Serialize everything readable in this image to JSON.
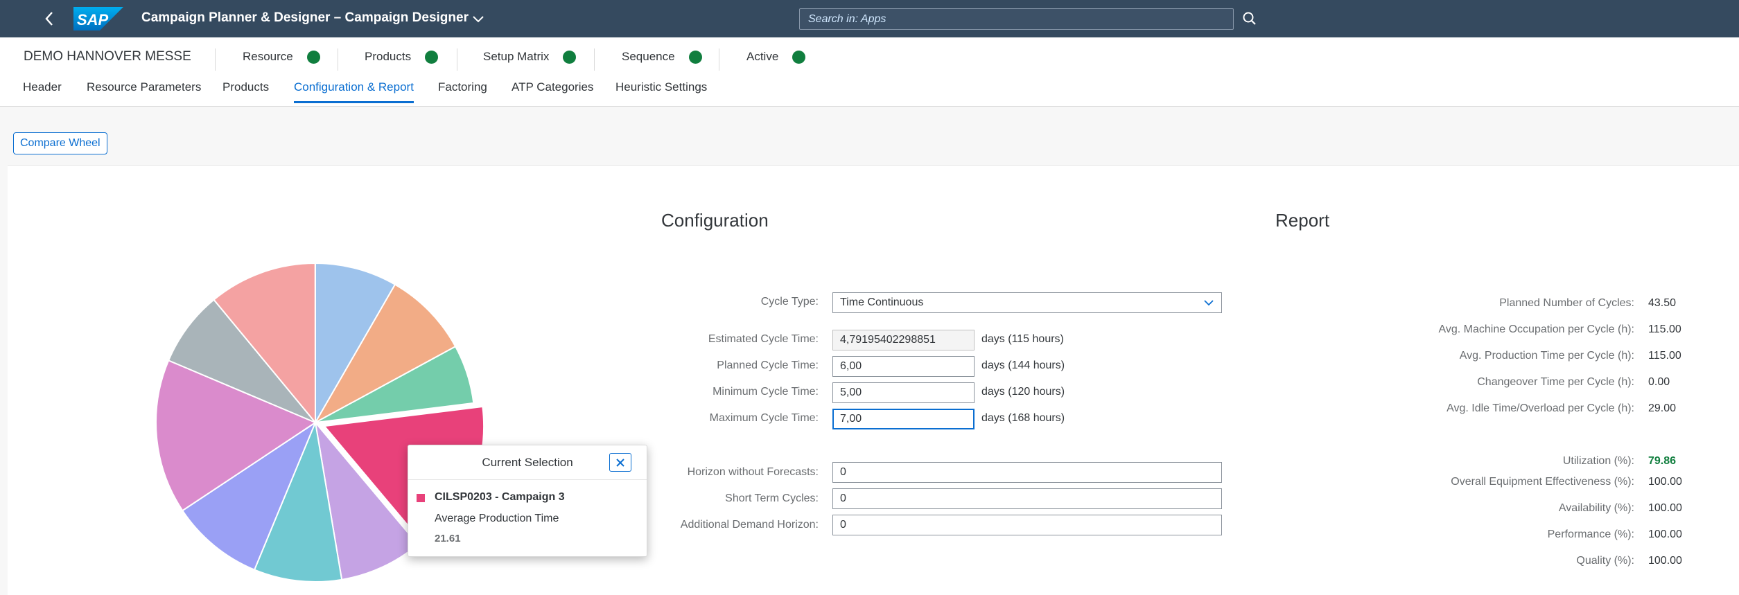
{
  "shell": {
    "logo_text": "SAP",
    "title": "Campaign Planner & Designer – Campaign Designer",
    "search_placeholder": "Search in: Apps"
  },
  "object": {
    "title": "DEMO HANNOVER MESSE",
    "statuses": [
      {
        "label": "Resource",
        "state": "green"
      },
      {
        "label": "Products",
        "state": "green"
      },
      {
        "label": "Setup Matrix",
        "state": "green"
      },
      {
        "label": "Sequence",
        "state": "green"
      },
      {
        "label": "Active",
        "state": "green"
      }
    ]
  },
  "tabs": [
    {
      "label": "Header"
    },
    {
      "label": "Resource Parameters"
    },
    {
      "label": "Products"
    },
    {
      "label": "Configuration & Report",
      "active": true
    },
    {
      "label": "Factoring"
    },
    {
      "label": "ATP Categories"
    },
    {
      "label": "Heuristic Settings"
    }
  ],
  "toolbar": {
    "compare_label": "Compare Wheel"
  },
  "configuration": {
    "title": "Configuration",
    "cycle_type_label": "Cycle Type:",
    "cycle_type_value": "Time Continuous",
    "estimated_label": "Estimated Cycle Time:",
    "estimated_value": "4,79195402298851",
    "estimated_unit": "days (115 hours)",
    "planned_label": "Planned Cycle Time:",
    "planned_value": "6,00",
    "planned_unit": "days (144 hours)",
    "minimum_label": "Minimum Cycle Time:",
    "minimum_value": "5,00",
    "minimum_unit": "days (120 hours)",
    "maximum_label": "Maximum Cycle Time:",
    "maximum_value": "7,00",
    "maximum_unit": "days (168 hours)",
    "horizon_label": "Horizon without Forecasts:",
    "horizon_value": "0",
    "short_term_label": "Short Term Cycles:",
    "short_term_value": "0",
    "additional_label": "Additional Demand Horizon:",
    "additional_value": "0"
  },
  "report": {
    "title": "Report",
    "rows": [
      {
        "label": "Planned Number of Cycles:",
        "value": "43.50"
      },
      {
        "label": "Avg. Machine Occupation per Cycle (h):",
        "value": "115.00"
      },
      {
        "label": "Avg. Production Time per Cycle (h):",
        "value": "115.00"
      },
      {
        "label": "Changeover Time per Cycle (h):",
        "value": "0.00"
      },
      {
        "label": "Avg. Idle Time/Overload per Cycle (h):",
        "value": "29.00"
      },
      {
        "label": "Utilization (%):",
        "value": "79.86"
      },
      {
        "label": "Overall Equipment Effectiveness (%):",
        "value": "100.00"
      },
      {
        "label": "Availability (%):",
        "value": "100.00"
      },
      {
        "label": "Performance (%):",
        "value": "100.00"
      },
      {
        "label": "Quality (%):",
        "value": "100.00"
      }
    ]
  },
  "wheel": {
    "slices": [
      {
        "color": "#9ec3ec",
        "share": 0.0833
      },
      {
        "color": "#f2ac86",
        "share": 0.0875
      },
      {
        "color": "#74cdab",
        "share": 0.0597
      },
      {
        "color": "#e8417a",
        "share": 0.1583,
        "selected": true
      },
      {
        "color": "#c5a3e4",
        "share": 0.0847
      },
      {
        "color": "#71c9d2",
        "share": 0.0889
      },
      {
        "color": "#9aa0f5",
        "share": 0.0944
      },
      {
        "color": "#da8bcc",
        "share": 0.1569
      },
      {
        "color": "#a9b4b9",
        "share": 0.0764
      },
      {
        "color": "#f4a2a2",
        "share": 0.1097
      }
    ]
  },
  "popover": {
    "title": "Current Selection",
    "item_name": "CILSP0203 - Campaign 3",
    "measure": "Average Production Time",
    "value": "21.61"
  }
}
